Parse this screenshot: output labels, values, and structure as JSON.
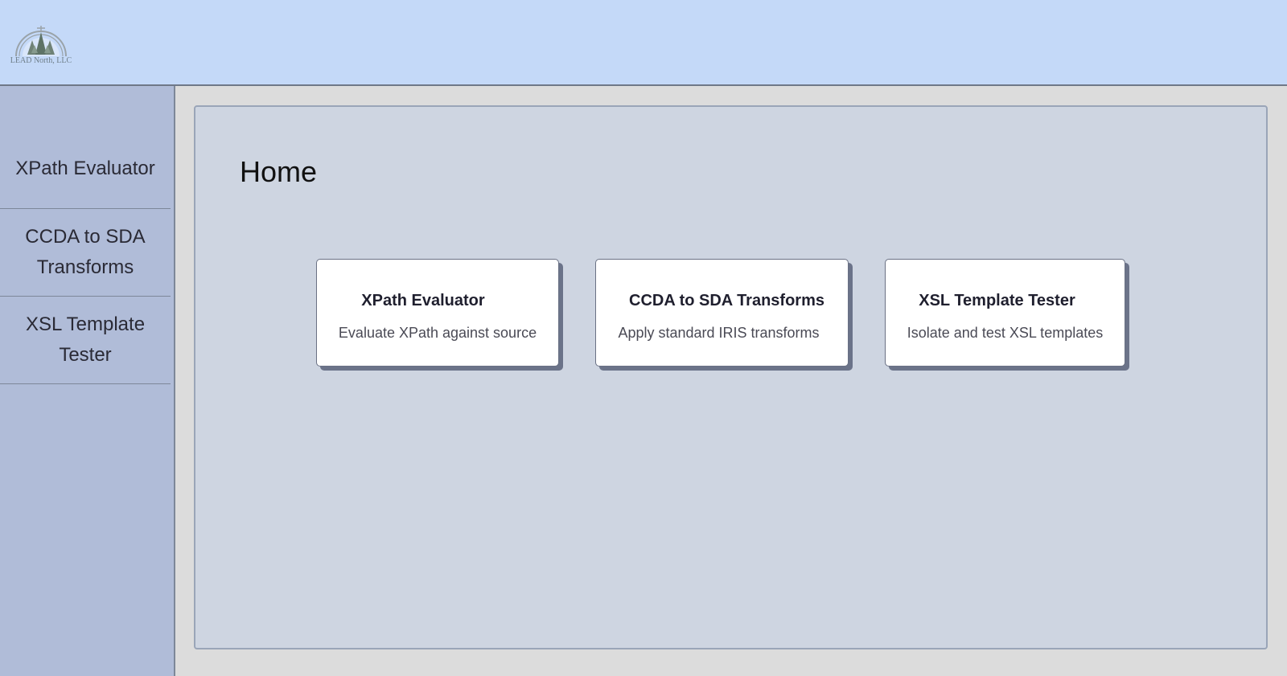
{
  "header": {
    "logo_text": "LEAD North, LLC",
    "logo_icon": "evergreen-trees-logo-icon"
  },
  "sidebar": {
    "items": [
      {
        "label": "XPath Evaluator"
      },
      {
        "label": "CCDA to SDA Transforms"
      },
      {
        "label": "XSL Template Tester"
      }
    ]
  },
  "main": {
    "title": "Home",
    "cards": [
      {
        "title": "XPath Evaluator",
        "description": "Evaluate XPath against source"
      },
      {
        "title": "CCDA to SDA Transforms",
        "description": "Apply standard IRIS transforms"
      },
      {
        "title": "XSL Template Tester",
        "description": "Isolate and test XSL templates"
      }
    ]
  },
  "colors": {
    "header_bg": "#c4d9f8",
    "sidebar_bg": "#b0bcd8",
    "panel_bg": "#ced5e1",
    "card_bg": "#ffffff",
    "card_shadow": "#6b7389"
  }
}
